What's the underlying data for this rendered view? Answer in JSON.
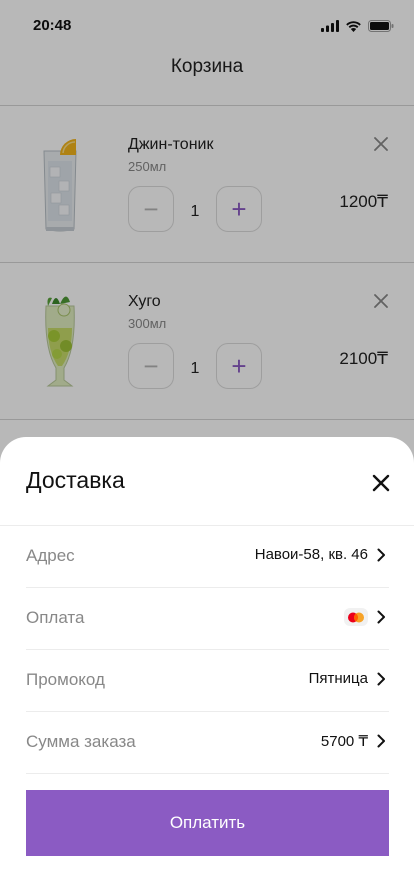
{
  "status_bar": {
    "time": "20:48"
  },
  "header": {
    "title": "Корзина"
  },
  "cart": {
    "items": [
      {
        "name": "Джин-тоник",
        "volume": "250мл",
        "quantity": "1",
        "price": "1200₸",
        "minus": "−",
        "plus": "+"
      },
      {
        "name": "Хуго",
        "volume": "300мл",
        "quantity": "1",
        "price": "2100₸",
        "minus": "−",
        "plus": "+"
      }
    ]
  },
  "sheet": {
    "title": "Доставка",
    "rows": [
      {
        "label": "Адрес",
        "value": "Навои-58, кв. 46"
      },
      {
        "label": "Оплата",
        "value": "",
        "icon": "mastercard-icon"
      },
      {
        "label": "Промокод",
        "value": "Пятница"
      },
      {
        "label": "Сумма заказа",
        "value": "5700 ₸"
      }
    ],
    "pay_label": "Оплатить"
  },
  "colors": {
    "accent": "#8b5bc3",
    "overlay": "rgba(0,0,0,0.28)"
  }
}
